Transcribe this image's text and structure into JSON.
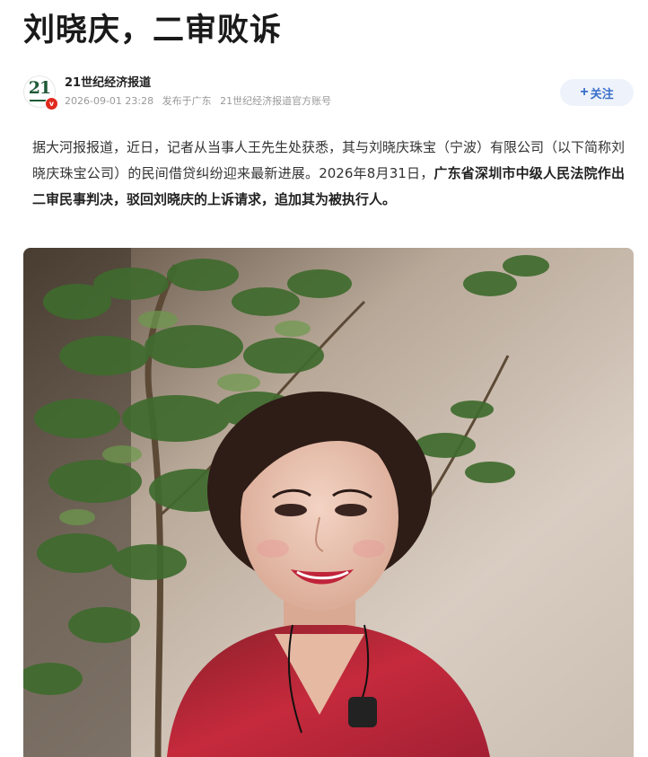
{
  "article": {
    "title": "刘晓庆，二审败诉",
    "author": {
      "logo_text": "21",
      "name": "21世纪经济报道",
      "timestamp": "2026-09-01 23:28",
      "location": "发布于广东",
      "account_note": "21世纪经济报道官方账号"
    },
    "follow_button": {
      "plus": "+",
      "label": "关注"
    },
    "body": {
      "text_plain": "据大河报报道，近日，记者从当事人王先生处获悉，其与刘晓庆珠宝（宁波）有限公司（以下简称刘晓庆珠宝公司）的民间借贷纠纷迎来最新进展。2026年8月31日，",
      "text_bold": "广东省深圳市中级人民法院作出二审民事判决，驳回刘晓庆的上诉请求，追加其为被执行人。"
    },
    "photo": {
      "icon": "portrait-photo"
    }
  },
  "colors": {
    "accent": "#3a6fc9",
    "follow_bg": "#eef3fb",
    "verified": "#e02a1e",
    "logo": "#1f5a37"
  }
}
